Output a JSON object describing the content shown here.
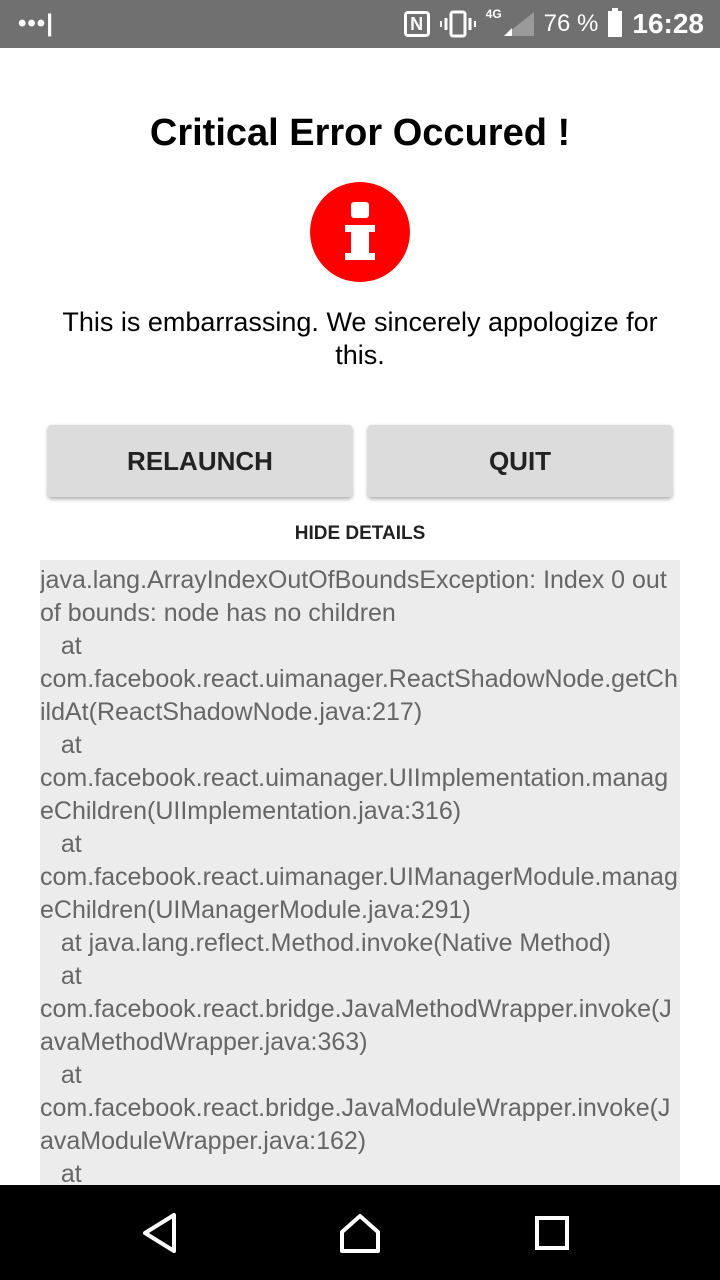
{
  "status_bar": {
    "notification_dots": "•••|",
    "nfc_label": "N",
    "network": "4G",
    "battery_percent": "76 %",
    "time": "16:28",
    "icons": [
      "nfc-icon",
      "vibrate-icon",
      "signal-icon",
      "battery-icon"
    ]
  },
  "dialog": {
    "title": "Critical Error Occured !",
    "icon": "error-info-icon",
    "message": "This is embarrassing. We sincerely appologize for this.",
    "relaunch_label": "RELAUNCH",
    "quit_label": "QUIT",
    "toggle_details_label": "HIDE DETAILS",
    "details": "java.lang.ArrayIndexOutOfBoundsException: Index 0 out of bounds: node has no children\n   at\ncom.facebook.react.uimanager.ReactShadowNode.getChildAt(ReactShadowNode.java:217)\n   at\ncom.facebook.react.uimanager.UIImplementation.manageChildren(UIImplementation.java:316)\n   at\ncom.facebook.react.uimanager.UIManagerModule.manageChildren(UIManagerModule.java:291)\n   at java.lang.reflect.Method.invoke(Native Method)\n   at\ncom.facebook.react.bridge.JavaMethodWrapper.invoke(JavaMethodWrapper.java:363)\n   at\ncom.facebook.react.bridge.JavaModuleWrapper.invoke(JavaModuleWrapper.java:162)\n   at"
  },
  "colors": {
    "status_bar": "#707070",
    "error_red": "#ff0000",
    "button_bg": "#dcdcdc",
    "details_bg": "#ececec",
    "details_text": "#666666"
  },
  "nav_bar": {
    "icons": [
      "back-icon",
      "home-icon",
      "recents-icon"
    ]
  }
}
